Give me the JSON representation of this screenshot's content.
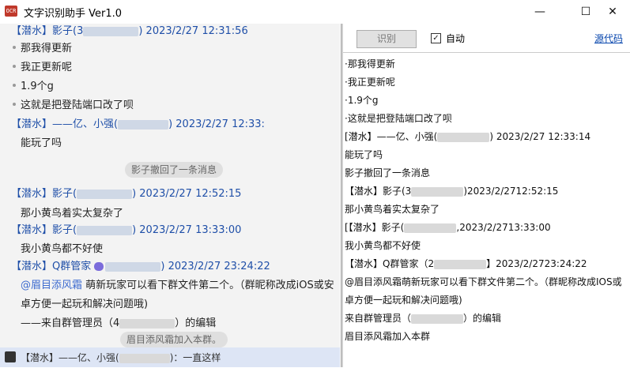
{
  "window": {
    "icon_text": "OCR",
    "title": "文字识别助手 Ver1.0",
    "min": "—",
    "max": "☐",
    "close": "✕"
  },
  "chat": {
    "messages": [
      {
        "header_pre": "【潜水】影子(3",
        "header_post": ") 2023/2/27 12:31:56"
      },
      {
        "text": "那我得更新"
      },
      {
        "text": "我正更新呢"
      },
      {
        "text": "1.9个g"
      },
      {
        "text": "这就是把登陆端口改了呗"
      },
      {
        "header_pre": "【潜水】——亿、小强(",
        "header_post": ") 2023/2/27 12:33:"
      },
      {
        "text": "能玩了吗"
      },
      {
        "system": "影子撤回了一条消息"
      },
      {
        "header_pre": "【潜水】影子(",
        "header_post": ") 2023/2/27 12:52:15"
      },
      {
        "text": "那小黄鸟着实太复杂了"
      },
      {
        "header_pre": "【潜水】影子(",
        "header_post": ") 2023/2/27 13:33:00"
      },
      {
        "text": "我小黄鸟都不好使"
      },
      {
        "header_pre": "【潜水】Q群管家",
        "header_post": ") 2023/2/27 23:24:22"
      },
      {
        "mention": "@眉目添风霜",
        "text": " 萌新玩家可以看下群文件第二个。（群昵称改成iOS或安"
      },
      {
        "text": "卓方便一起玩和解决问题哦)"
      },
      {
        "text_pre": "——来自群管理员（4",
        "text_post": "）的编辑"
      },
      {
        "system": "眉目添风霜加入本群。"
      }
    ],
    "footer": {
      "pre": "【潜水】——亿、小强(",
      "post": ")：一直这样"
    }
  },
  "toolbar": {
    "recognize_label": "识别",
    "auto_checked": "✓",
    "auto_label": "自动",
    "source_label": "源代码"
  },
  "output": {
    "lines": [
      "·那我得更新",
      "·我正更新呢",
      "·1.9个g",
      "·这就是把登陆端口改了呗",
      "[潜水】——亿、小强(",
      "能玩了吗",
      "影子撤回了一条消息",
      "【潜水】影子(3",
      "那小黄鸟着实太复杂了",
      "[【潜水】影子(",
      "我小黄鸟都不好使",
      "【潜水】Q群管家（2",
      "@眉目添风霜萌新玩家可以看下群文件第二个。（群昵称改成IOS或",
      "卓方便一起玩和解决问题哦)",
      "来自群管理员（",
      "眉目添风霜加入本群"
    ],
    "line_tails": {
      "4": ") 2023/2/27 12:33:14",
      "7": ")2023/2/2712:52:15",
      "9": ",2023/2/2713:33:00",
      "11": "】2023/2/2723:24:22",
      "14": "）的编辑"
    }
  }
}
